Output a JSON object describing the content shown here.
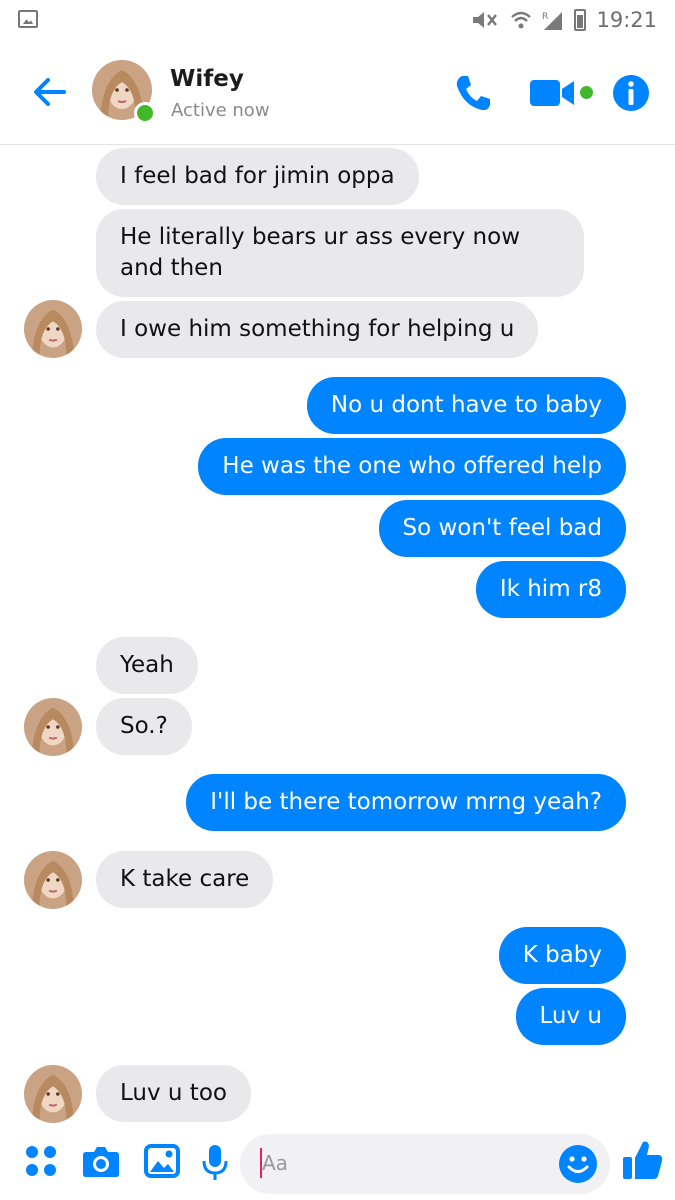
{
  "status_bar": {
    "time": "19:21",
    "signal_label": "R"
  },
  "header": {
    "name": "Wifey",
    "status": "Active now"
  },
  "colors": {
    "accent": "#0084ff",
    "online": "#42b72a",
    "incoming_bg": "#e9e9eb"
  },
  "messages": [
    {
      "from": "them",
      "text": "I feel bad for jimin oppa"
    },
    {
      "from": "them",
      "text_line1": "He literally bears ur ass every now",
      "text_line2": "and then"
    },
    {
      "from": "them",
      "text": "I owe him something for helping u"
    },
    {
      "from": "me",
      "text": "No u dont have to baby"
    },
    {
      "from": "me",
      "text": "He was the one who offered help"
    },
    {
      "from": "me",
      "text": "So won't feel bad"
    },
    {
      "from": "me",
      "text": "Ik him r8"
    },
    {
      "from": "them",
      "text": "Yeah"
    },
    {
      "from": "them",
      "text": "So.?"
    },
    {
      "from": "me",
      "text": "I'll be there tomorrow mrng yeah?"
    },
    {
      "from": "them",
      "text": "K take care"
    },
    {
      "from": "me",
      "text": "K baby"
    },
    {
      "from": "me",
      "text": "Luv u"
    },
    {
      "from": "them",
      "text": "Luv u too"
    }
  ],
  "composer": {
    "placeholder": "Aa",
    "icons": [
      "apps-icon",
      "camera-icon",
      "gallery-icon",
      "microphone-icon",
      "emoji-icon",
      "thumbs-up-icon"
    ]
  }
}
